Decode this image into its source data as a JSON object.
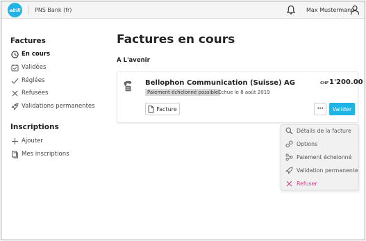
{
  "app": {
    "logo_text": "eBill",
    "bank_name": "PNS Bank (fr)",
    "user_name": "Max Mustermann"
  },
  "sidebar": {
    "factures_heading": "Factures",
    "factures_items": [
      {
        "label": "En cours",
        "icon": "clock-icon",
        "active": true
      },
      {
        "label": "Validées",
        "icon": "calendar-check-icon",
        "active": false
      },
      {
        "label": "Réglées",
        "icon": "check-icon",
        "active": false
      },
      {
        "label": "Refusées",
        "icon": "x-icon",
        "active": false
      },
      {
        "label": "Validations permanentes",
        "icon": "rocket-icon",
        "active": false
      }
    ],
    "inscriptions_heading": "Inscriptions",
    "inscriptions_items": [
      {
        "label": "Ajouter",
        "icon": "plus-icon"
      },
      {
        "label": "Mes inscriptions",
        "icon": "documents-icon"
      }
    ]
  },
  "main": {
    "title": "Factures en cours",
    "section_label": "A L'avenir",
    "bill": {
      "company": "Bellophon Communication (Suisse) AG",
      "badge": "Paiement échelonné possible",
      "due": "Echue le 8 août 2019",
      "currency": "CHF",
      "amount": "1'200.00",
      "facture_label": "Facture",
      "more_label": "···",
      "valider_label": "Valider"
    },
    "dropdown": [
      {
        "label": "Détails de la facture",
        "icon": "magnifier-icon"
      },
      {
        "label": "Options",
        "icon": "options-icon"
      },
      {
        "label": "Paiement échelonné",
        "icon": "installments-icon"
      },
      {
        "label": "Validation permanente",
        "icon": "rocket-icon"
      },
      {
        "label": "Refuser",
        "icon": "x-icon",
        "danger": true
      }
    ]
  },
  "colors": {
    "accent": "#1fb3e6",
    "danger": "#d63a8a",
    "badge_bg": "#d9d9d9"
  }
}
